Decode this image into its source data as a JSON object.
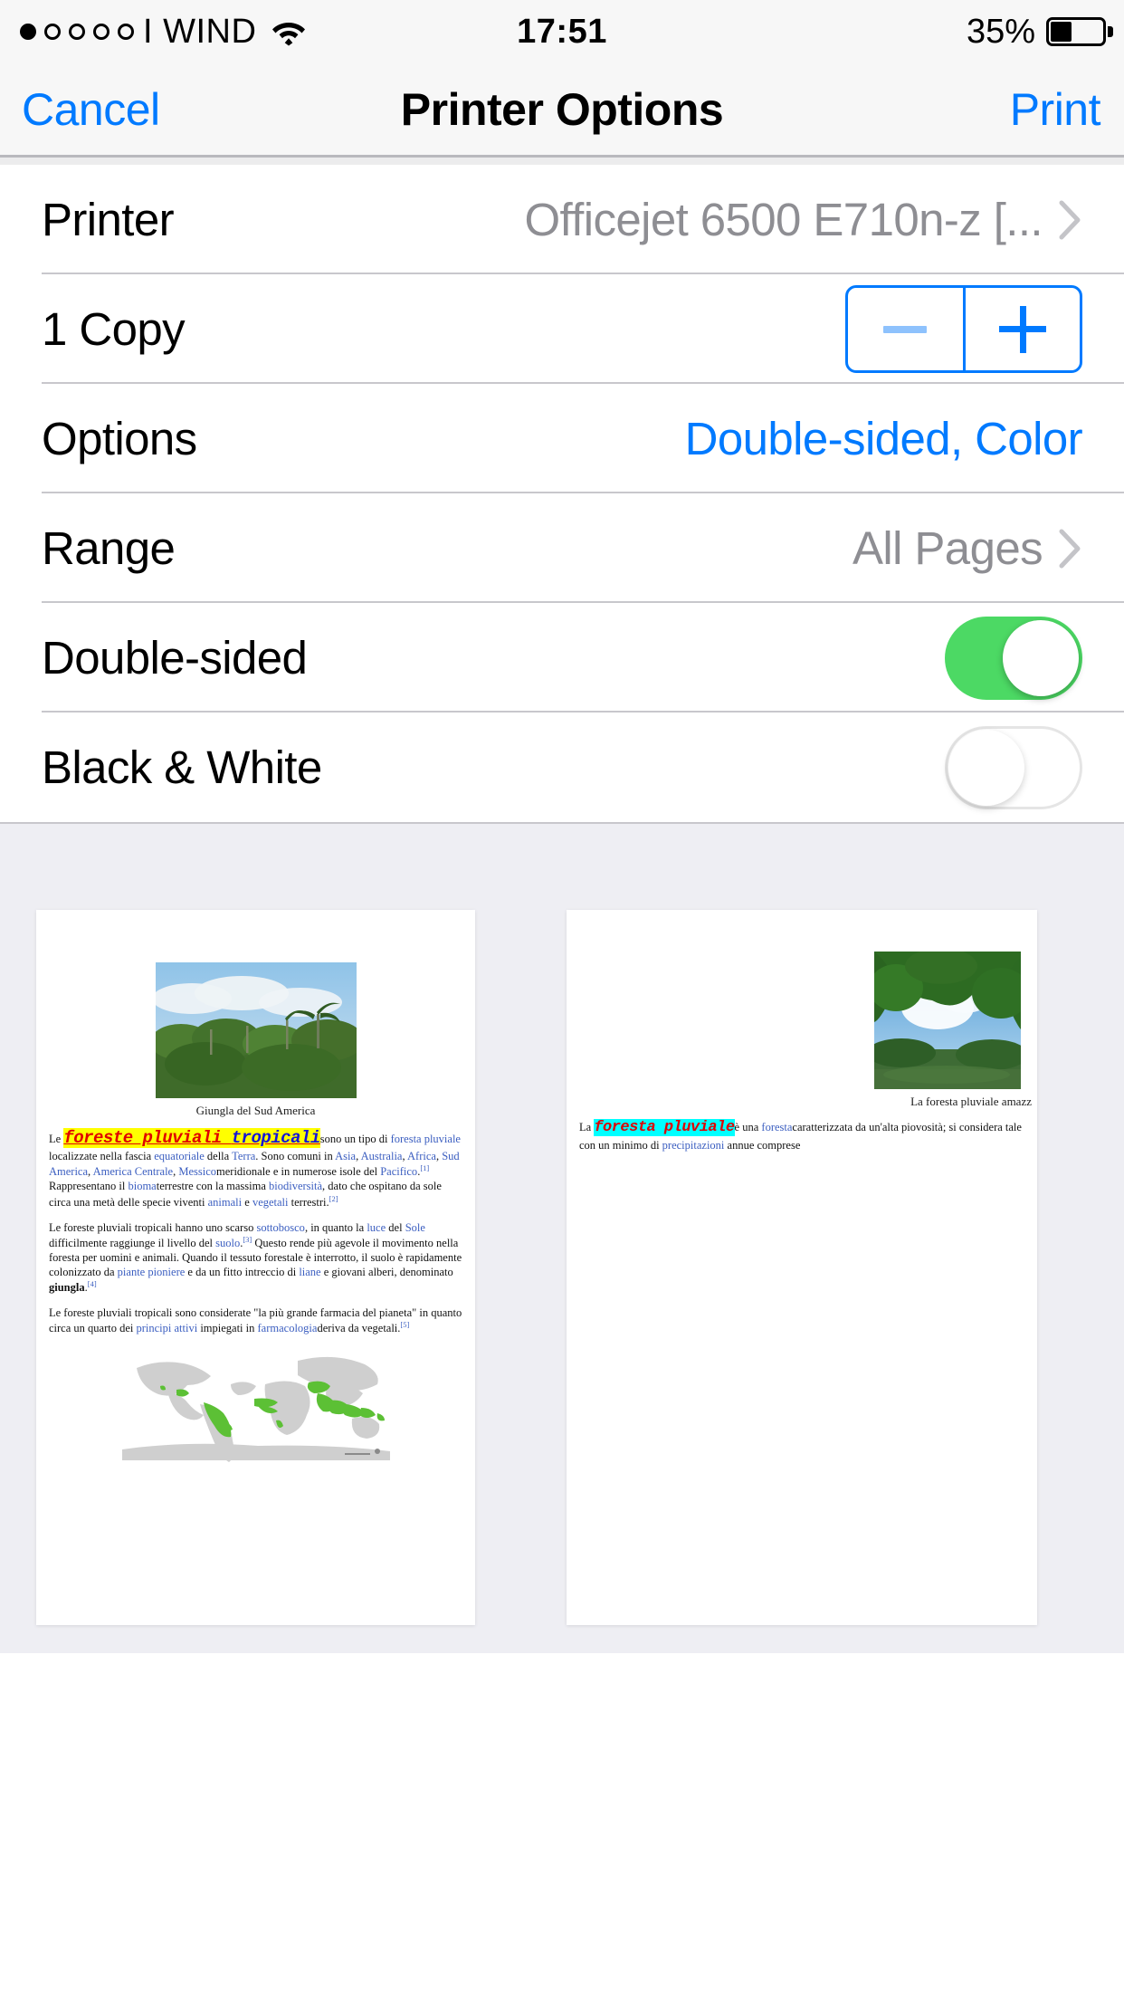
{
  "status_bar": {
    "signal_dots_total": 5,
    "signal_dots_filled": 1,
    "carrier": "I WIND",
    "wifi_icon": "wifi-icon",
    "time": "17:51",
    "battery_percent": "35%",
    "battery_level": 35
  },
  "navbar": {
    "cancel_label": "Cancel",
    "title": "Printer Options",
    "print_label": "Print"
  },
  "rows": {
    "printer": {
      "label": "Printer",
      "value": "Officejet 6500 E710n-z [...",
      "chevron_icon": "chevron-right-icon"
    },
    "copies": {
      "label": "1 Copy",
      "count": 1,
      "minus_icon": "minus-icon",
      "plus_icon": "plus-icon",
      "minus_enabled": false,
      "plus_enabled": true
    },
    "options": {
      "label": "Options",
      "value": "Double-sided, Color"
    },
    "range": {
      "label": "Range",
      "value": "All Pages",
      "chevron_icon": "chevron-right-icon"
    },
    "double_sided": {
      "label": "Double-sided",
      "state": "on"
    },
    "black_and_white": {
      "label": "Black & White",
      "state": "off"
    }
  },
  "colors": {
    "accent_blue": "#007aff",
    "accent_blue_disabled": "#8ec2fd",
    "toggle_on_green": "#4cd964",
    "value_gray": "#8e8e93",
    "separator": "#c8c7cc",
    "bar_background": "#f7f7f7",
    "preview_background": "#eeeef3",
    "highlight_yellow": "#ffff00",
    "highlight_cyan": "#00ffff",
    "highlight_text_red": "#e00000",
    "highlight_text_blue": "#1414d8",
    "wiki_link_blue": "#3b5ec0"
  },
  "preview": {
    "page_1": {
      "figure_caption": "Giungla del Sud America",
      "lead_prefix": "Le ",
      "lead_highlight_red": "foreste pluviali ",
      "lead_highlight_blue": "tropicali",
      "paragraph_1": "sono un tipo di foresta pluviale localizzate nella fascia equatoriale della Terra. Sono comuni in Asia, Australia, Africa, Sud America, America Centrale, Messico meridionale e in numerose isole del Pacifico.[1] Rappresentano il bioma terrestre con la massima biodiversità, dato che ospitano da sole circa una metà delle specie viventi animali e vegetali terrestri.[2]",
      "paragraph_2": "Le foreste pluviali tropicali hanno uno scarso sottobosco, in quanto la luce del Sole difficilmente raggiunge il livello del suolo.[3] Questo rende più agevole il movimento nella foresta per uomini e animali. Quando il tessuto forestale è interrotto, il suolo è rapidamente colonizzato da piante pioniere e da un fitto intreccio di liane e giovani alberi, denominato giungla.[4]",
      "paragraph_3": "Le foreste pluviali tropicali sono considerate \"la più grande farmacia del pianeta\" in quanto circa un quarto dei principi attivi impiegati in farmacologia deriva da vegetali.[5]",
      "map_caption": "world-distribution-map"
    },
    "page_2": {
      "figure_caption": "La foresta pluviale amazz",
      "lead_prefix": "La ",
      "lead_highlight": "foresta pluviale",
      "paragraph_1": "è una foresta caratterizzata da ... si considera tale con un minimo di precipitazioni annue co"
    }
  }
}
